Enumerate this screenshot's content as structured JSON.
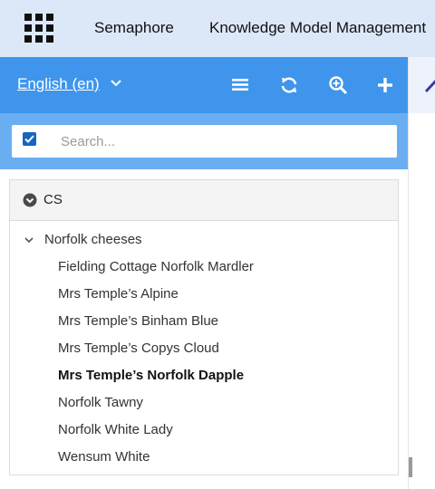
{
  "header": {
    "brand": "Semaphore",
    "app_title": "Knowledge Model Management"
  },
  "toolbar": {
    "language_label": "English (en)",
    "icons": [
      "list-icon",
      "refresh-icon",
      "zoom-in-icon",
      "add-icon"
    ]
  },
  "search": {
    "placeholder": "Search...",
    "checkbox_checked": true,
    "value": ""
  },
  "tree": {
    "scheme_label": "CS",
    "concept_label": "Norfolk cheeses",
    "children": [
      {
        "label": "Fielding Cottage Norfolk Mardler",
        "selected": false
      },
      {
        "label": "Mrs Temple’s Alpine",
        "selected": false
      },
      {
        "label": "Mrs Temple’s Binham Blue",
        "selected": false
      },
      {
        "label": "Mrs Temple’s Copys Cloud",
        "selected": false
      },
      {
        "label": "Mrs Temple’s Norfolk Dapple",
        "selected": true
      },
      {
        "label": "Norfolk Tawny",
        "selected": false
      },
      {
        "label": "Norfolk White Lady",
        "selected": false
      },
      {
        "label": "Wensum White",
        "selected": false
      }
    ]
  },
  "colors": {
    "topbar": "#dce8f7",
    "toolbar": "#3f95ec",
    "search_area": "#6aaef2",
    "accent": "#1565c0"
  }
}
